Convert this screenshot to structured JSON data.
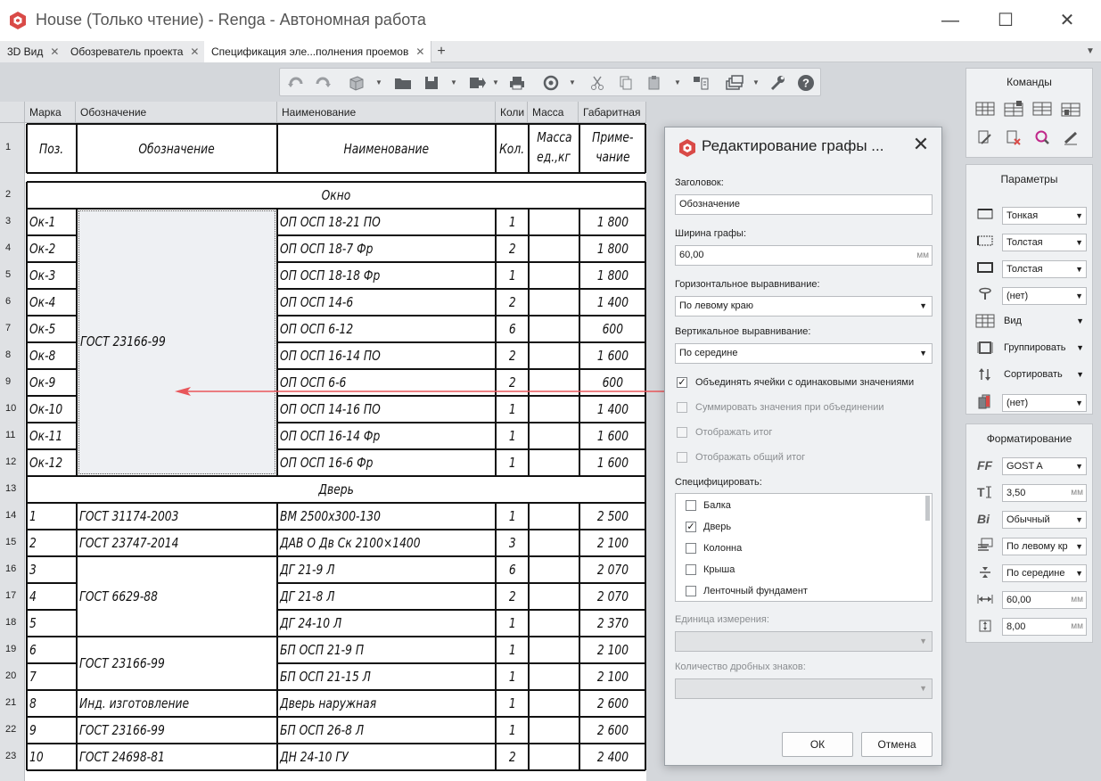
{
  "window": {
    "title": "House (Только чтение) - Renga - Автономная работа",
    "minimize": "—",
    "maximize": "☐",
    "close": "✕"
  },
  "tabs": [
    {
      "label": "3D Вид"
    },
    {
      "label": "Обозреватель проекта"
    },
    {
      "label": "Спецификация эле...полнения проемов",
      "active": true
    }
  ],
  "tab_add": "+",
  "tab_more": "▼",
  "toolbar": {
    "icons": [
      "undo-icon",
      "redo-icon",
      "3d-view-icon",
      "open-folder-icon",
      "save-icon",
      "export-icon",
      "print-icon",
      "refresh-icon",
      "cut-icon",
      "copy-icon",
      "paste-icon",
      "layout-icon",
      "layers-icon",
      "settings-wrench-icon",
      "help-icon"
    ]
  },
  "sheet": {
    "column_headers": [
      "Марка",
      "Обозначение",
      "Наименование",
      "Коли",
      "Масса",
      "Габаритная"
    ],
    "row_numbers": [
      "1",
      "2",
      "3",
      "4",
      "5",
      "6",
      "7",
      "8",
      "9",
      "10",
      "11",
      "12",
      "13",
      "14",
      "15",
      "16",
      "17",
      "18",
      "19",
      "20",
      "21",
      "22",
      "23"
    ],
    "header_row": {
      "pos": "Поз.",
      "designation": "Обозначение",
      "name": "Наименование",
      "qty": "Кол.",
      "mass1": "Масса",
      "mass2": "ед.,кг",
      "note1": "Приме-",
      "note2": "чание"
    },
    "group_window": "Окно",
    "group_door": "Дверь",
    "window_merged_designation": "ГОСТ 23166-99",
    "window_rows": [
      {
        "mark": "Ок-1",
        "name": "ОП ОСП 18-21 ПО",
        "qty": "1",
        "note": "1 800"
      },
      {
        "mark": "Ок-2",
        "name": "ОП ОСП 18-7 Фр",
        "qty": "2",
        "note": "1 800"
      },
      {
        "mark": "Ок-3",
        "name": "ОП ОСП 18-18 Фр",
        "qty": "1",
        "note": "1 800"
      },
      {
        "mark": "Ок-4",
        "name": "ОП ОСП 14-6",
        "qty": "2",
        "note": "1 400"
      },
      {
        "mark": "Ок-5",
        "name": "ОП ОСП 6-12",
        "qty": "6",
        "note": "600"
      },
      {
        "mark": "Ок-8",
        "name": "ОП ОСП 16-14 ПО",
        "qty": "2",
        "note": "1 600"
      },
      {
        "mark": "Ок-9",
        "name": "ОП ОСП 6-6",
        "qty": "2",
        "note": "600"
      },
      {
        "mark": "Ок-10",
        "name": "ОП ОСП 14-16 ПО",
        "qty": "1",
        "note": "1 400"
      },
      {
        "mark": "Ок-11",
        "name": "ОП ОСП 16-14 Фр",
        "qty": "1",
        "note": "1 600"
      },
      {
        "mark": "Ок-12",
        "name": "ОП ОСП 16-6 Фр",
        "qty": "1",
        "note": "1 600"
      }
    ],
    "door_rows": [
      {
        "mark": "1",
        "name": "ВМ 2500х300-130",
        "qty": "1",
        "note": "2 500"
      },
      {
        "mark": "2",
        "name": "ДАВ О Дв Ск 2100×1400",
        "qty": "3",
        "note": "2 100"
      },
      {
        "mark": "3",
        "name": "ДГ 21-9 Л",
        "qty": "6",
        "note": "2 070"
      },
      {
        "mark": "4",
        "name": "ДГ 21-8 Л",
        "qty": "2",
        "note": "2 070"
      },
      {
        "mark": "5",
        "name": "ДГ 24-10 Л",
        "qty": "1",
        "note": "2 370"
      },
      {
        "mark": "6",
        "name": "БП ОСП 21-9 П",
        "qty": "1",
        "note": "2 100"
      },
      {
        "mark": "7",
        "name": "БП ОСП 21-15 Л",
        "qty": "1",
        "note": "2 100"
      },
      {
        "mark": "8",
        "name": "Дверь наружная",
        "qty": "1",
        "note": "2 600"
      },
      {
        "mark": "9",
        "name": "БП ОСП 26-8 Л",
        "qty": "1",
        "note": "2 600"
      },
      {
        "mark": "10",
        "name": "ДН 24-10 ГУ",
        "qty": "2",
        "note": "2 400"
      }
    ],
    "door_designations": [
      {
        "text": "ГОСТ 31174-2003"
      },
      {
        "text": "ГОСТ 23747-2014"
      },
      {
        "text": "ГОСТ 6629-88"
      },
      {
        "text": "ГОСТ 23166-99"
      },
      {
        "text": "Инд. изготовление"
      },
      {
        "text": "ГОСТ 23166-99"
      },
      {
        "text": "ГОСТ 24698-81"
      }
    ]
  },
  "dialog": {
    "title": "Редактирование графы ...",
    "close": "✕",
    "header_label": "Заголовок:",
    "header_value": "Обозначение",
    "width_label": "Ширина графы:",
    "width_value": "60,00",
    "width_unit": "мм",
    "halign_label": "Горизонтальное выравнивание:",
    "halign_value": "По левому краю",
    "valign_label": "Вертикальное выравнивание:",
    "valign_value": "По середине",
    "merge_label": "Объединять ячейки с одинаковыми значениями",
    "merge_checked": true,
    "sum_label": "Суммировать значения при объединении",
    "total_label": "Отображать итог",
    "grand_total_label": "Отображать общий итог",
    "specify_label": "Специфицировать:",
    "spec_items": [
      {
        "label": "Балка",
        "checked": false
      },
      {
        "label": "Дверь",
        "checked": true
      },
      {
        "label": "Колонна",
        "checked": false
      },
      {
        "label": "Крыша",
        "checked": false
      },
      {
        "label": "Ленточный фундамент",
        "checked": false
      }
    ],
    "unit_label": "Единица измерения:",
    "decimals_label": "Количество дробных знаков:",
    "ok": "ОК",
    "cancel": "Отмена"
  },
  "commands_panel": {
    "title": "Команды"
  },
  "params_panel": {
    "title": "Параметры",
    "rows": [
      {
        "icon": "thin-border-icon",
        "value": "Тонкая",
        "dropdown": true
      },
      {
        "icon": "dotted-border-icon",
        "value": "Толстая",
        "dropdown": true
      },
      {
        "icon": "thick-border-icon",
        "value": "Толстая",
        "dropdown": true
      },
      {
        "icon": "filter-icon",
        "value": "(нет)",
        "dropdown": true
      },
      {
        "icon": "table-view-icon",
        "value": "Вид",
        "dropdown": false
      },
      {
        "icon": "group-icon",
        "value": "Группировать",
        "dropdown": false
      },
      {
        "icon": "sort-icon",
        "value": "Сортировать",
        "dropdown": false
      },
      {
        "icon": "style-icon",
        "value": "(нет)",
        "dropdown": true
      }
    ]
  },
  "format_panel": {
    "title": "Форматирование",
    "font": "GOST A",
    "font_size": "3,50",
    "font_style": "Обычный",
    "halign": "По левому кр",
    "valign": "По середине",
    "width": "60,00",
    "height": "8,00",
    "unit": "мм",
    "ff_glyph": "FF",
    "bi_glyph": "Bi"
  },
  "colors": {
    "arrow": "#e8565a",
    "brand": "#d94a47"
  }
}
